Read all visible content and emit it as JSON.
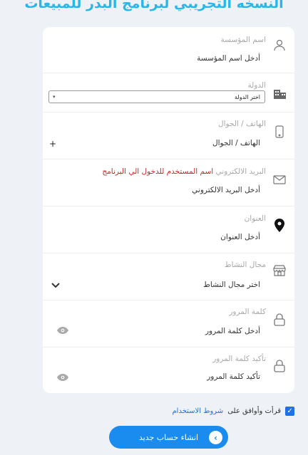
{
  "title": "النسخه التجريبي لبرنامج البدر للمبيعات",
  "fields": {
    "org": {
      "label": "اسم المؤسسة",
      "placeholder": "أدخل اسم المؤسسة"
    },
    "country": {
      "label": "الدولة",
      "selected": "اختر الدولة"
    },
    "phone": {
      "label": "الهاتف / الجوال",
      "placeholder": "الهاتف / الجوال",
      "prefix": "+"
    },
    "email": {
      "label": "البريد الالكتروني",
      "note": "اسم المستخدم للدخول الي البرنامج",
      "placeholder": "أدخل البريد الالكتروني"
    },
    "address": {
      "label": "العنوان",
      "placeholder": "أدخل العنوان"
    },
    "activity": {
      "label": "مجال النشاط",
      "selected": "اختر مجال النشاط"
    },
    "password": {
      "label": "كلمة المرور",
      "placeholder": "أدخل كلمة المرور"
    },
    "confirm": {
      "label": "تأكيد كلمة المرور",
      "placeholder": "تأكيد كلمة المرور"
    }
  },
  "agreement": {
    "text": "قرأت وأوافق على",
    "link": "شروط الاستخدام",
    "checked": true
  },
  "submit_label": "انشاء حساب جديد",
  "icons": {
    "org": "user-icon",
    "country": "building-icon",
    "phone": "mobile-icon",
    "email": "envelope-icon",
    "address": "map-pin-icon",
    "activity": "store-icon",
    "password": "lock-icon",
    "confirm": "lock-icon",
    "eye": "eye-icon",
    "chevron": "chevron-down-icon",
    "submit": "chevron-right-icon"
  },
  "colors": {
    "title": "#27b7e8",
    "accent": "#1a8cf0",
    "note": "#c62828",
    "background": "#eef1f5"
  }
}
